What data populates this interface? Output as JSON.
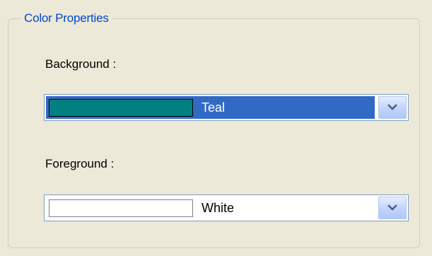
{
  "groupbox": {
    "title": "Color Properties"
  },
  "background": {
    "label": "Background :",
    "selected_color_name": "Teal",
    "swatch_color": "#008080",
    "selection_highlight": "#316ac5"
  },
  "foreground": {
    "label": "Foreground :",
    "selected_color_name": "White",
    "swatch_color": "#ffffff"
  },
  "icons": {
    "dropdown": "chevron-down-icon"
  }
}
